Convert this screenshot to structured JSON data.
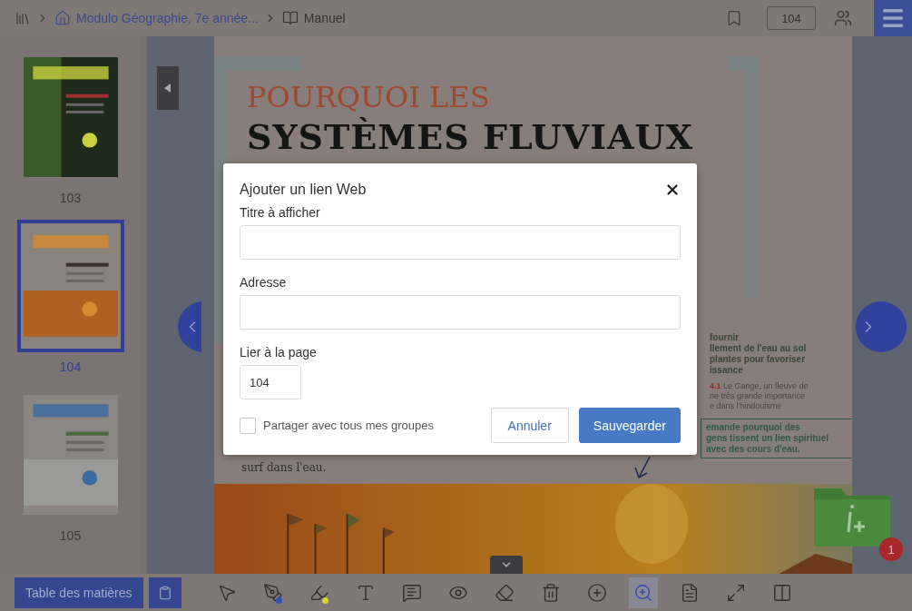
{
  "top_bar": {
    "breadcrumb": [
      {
        "kind": "library"
      },
      {
        "kind": "home",
        "label": "Modulo Géographie, 7e année..."
      },
      {
        "kind": "book",
        "label": "Manuel"
      }
    ],
    "page_number": "104"
  },
  "thumbnails": [
    {
      "label": "103",
      "selected": false,
      "kind": "picture"
    },
    {
      "label": "104",
      "selected": true,
      "kind": "picture"
    },
    {
      "label": "105",
      "selected": false,
      "kind": "picture"
    }
  ],
  "page": {
    "title_line_1": "POURQUOI LES",
    "title_line_2": "SYSTÈMES FLUVIAUX",
    "body_end": "surf dans l'eau.",
    "side_text": [
      "fournir",
      "llement de l'eau au sol",
      "plantes pour favoriser",
      "issance"
    ],
    "caption_number": "4.1",
    "caption_lines": [
      "Le Gange, un fleuve de",
      "ne très grande importance",
      "e dans l'hindouisme"
    ],
    "note_lines": [
      "emande pourquoi des",
      "gens tissent un lien spirituel",
      "avec des cours d'eau."
    ],
    "resources_badge": "1"
  },
  "toolbar": {
    "contents_button": "Table des matières",
    "tools": [
      {
        "kind": "select",
        "selected": false
      },
      {
        "kind": "pen",
        "selected": false,
        "color": "#2f4fb5"
      },
      {
        "kind": "highlighter",
        "selected": false,
        "color": "#d8d830"
      },
      {
        "kind": "text",
        "selected": false
      },
      {
        "kind": "comment",
        "selected": false
      },
      {
        "kind": "eye",
        "selected": false
      },
      {
        "kind": "eraser",
        "selected": false
      },
      {
        "kind": "trash",
        "selected": false
      },
      {
        "kind": "add",
        "selected": false
      },
      {
        "kind": "zoom",
        "selected": true
      },
      {
        "kind": "fit",
        "selected": false
      },
      {
        "kind": "fullscreen",
        "selected": false
      },
      {
        "kind": "pages",
        "selected": false
      }
    ]
  },
  "dialog": {
    "title": "Ajouter un lien Web",
    "fields": [
      {
        "label": "Titre à afficher"
      },
      {
        "label": "Adresse"
      }
    ],
    "page_label": "Lier à la page",
    "page_value": "104",
    "share": {
      "label": "Partager avec tous mes groupes",
      "checked": false
    },
    "buttons": [
      {
        "kind": "secondary",
        "label": "Annuler"
      },
      {
        "kind": "primary",
        "label": "Sauvegarder"
      }
    ]
  }
}
